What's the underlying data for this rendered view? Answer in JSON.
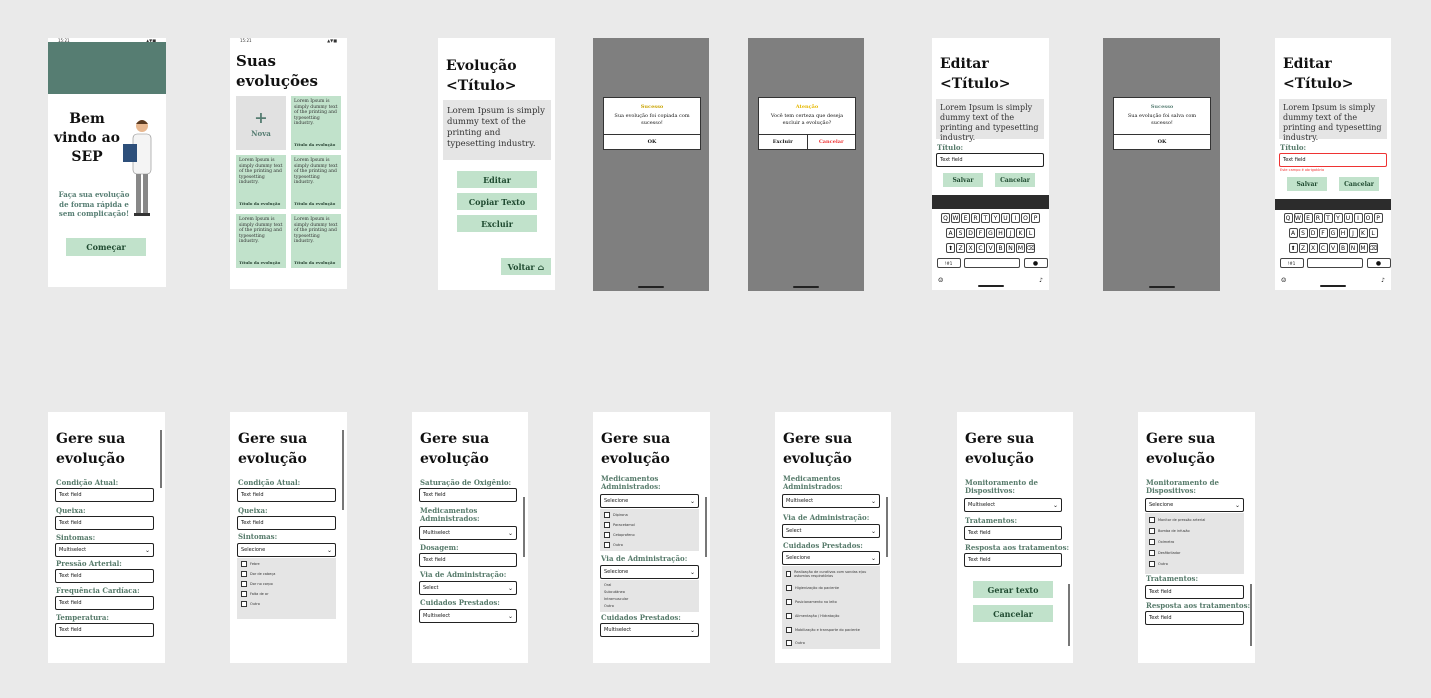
{
  "welcome": {
    "status_time": "15:21",
    "status_icons": "▲▼■",
    "title": "Bem vindo ao SEP",
    "subtitle": "Faça sua evolução de forma rápida e sem complicação!",
    "button": "Começar",
    "banner_color": "#567d72"
  },
  "list_screen": {
    "status_time": "15:21",
    "status_icons": "▲▼■",
    "title": "Suas evoluções",
    "new_label": "Nova",
    "plus": "+",
    "card_text": "Lorem Ipsum is simply dummy text of the printing and typesetting industry.",
    "card_title": "Título da evolução"
  },
  "detail": {
    "title_line1": "Evolução",
    "title_line2": "<Título>",
    "body": "Lorem Ipsum is simply dummy text of the printing and typesetting industry.",
    "edit": "Editar",
    "copy": "Copiar Texto",
    "delete": "Excluir",
    "back": "Voltar",
    "back_icon": "home-icon"
  },
  "dialog_success_copy": {
    "title": "Sucesso",
    "body": "Sua evolução foi copiada com sucesso!",
    "ok": "OK",
    "title_color": "#c9a300"
  },
  "dialog_attention": {
    "title": "Atenção",
    "body": "Você tem certeza que deseja excluir a evolução?",
    "confirm": "Excluir",
    "cancel": "Cancelar",
    "title_color": "#e6b800",
    "cancel_color": "#e33"
  },
  "dialog_success_save": {
    "title": "Sucesso",
    "body": "Sua evolução foi salva com sucesso!",
    "ok": "OK"
  },
  "edit": {
    "title_line1": "Editar",
    "title_line2": "<Título>",
    "body": "Lorem Ipsum is simply dummy text of the printing and typesetting industry.",
    "field_label": "Título:",
    "field_value": "Text field",
    "save": "Salvar",
    "cancel": "Cancelar",
    "error": "Este campo é obrigatório",
    "kb_row1": [
      "Q",
      "W",
      "E",
      "R",
      "T",
      "Y",
      "U",
      "I",
      "O",
      "P"
    ],
    "kb_row2": [
      "A",
      "S",
      "D",
      "F",
      "G",
      "H",
      "J",
      "K",
      "L"
    ],
    "kb_row3": [
      "⬆",
      "Z",
      "X",
      "C",
      "V",
      "B",
      "N",
      "M",
      "⌫"
    ],
    "kb_num": "!#1",
    "kb_go": "●"
  },
  "gere": {
    "title_line1": "Gere sua",
    "title_line2": "evolução",
    "text_field": "Text field",
    "multiselect": "Multiselect",
    "select": "Selecione",
    "select_en": "Select",
    "labels": {
      "condicao": "Condição Atual:",
      "queixa": "Queixa:",
      "sintomas": "Sintomas:",
      "pressao": "Pressão Arterial:",
      "freq": "Frequência Cardíaca:",
      "temp": "Temperatura:",
      "sat": "Saturação de Oxigênio:",
      "meds": "Medicamentos Administrados:",
      "dosagem": "Dosagem:",
      "via": "Via de Administração:",
      "cuidados": "Cuidados Prestados:",
      "monit": "Monitoramento de Dispositivos:",
      "trat": "Tratamentos:",
      "resp": "Resposta aos tratamentos:"
    },
    "sintomas_opts": [
      "Febre",
      "Dor de cabeça",
      "Dor no corpo",
      "Falta de ar",
      "Outro"
    ],
    "meds_opts": [
      "Dipirona",
      "Paracetamol",
      "Cetoprofeno",
      "Outro"
    ],
    "via_opts": [
      "Oral",
      "Subcutâneo",
      "Intramuscular",
      "Outro"
    ],
    "cuidados_opts": [
      "Realização de curativos com sondas e/ou ostomias respiratórias",
      "Higienização do paciente",
      "Posicionamento no leito",
      "Alimentação / Hidratação",
      "Mobilização e transporte do paciente",
      "Outro"
    ],
    "monit_opts": [
      "Monitor de pressão arterial",
      "Bomba de infusão",
      "Oxímetro",
      "Desfibrilador",
      "Outro"
    ],
    "gen": "Gerar texto",
    "cancel": "Cancelar"
  }
}
